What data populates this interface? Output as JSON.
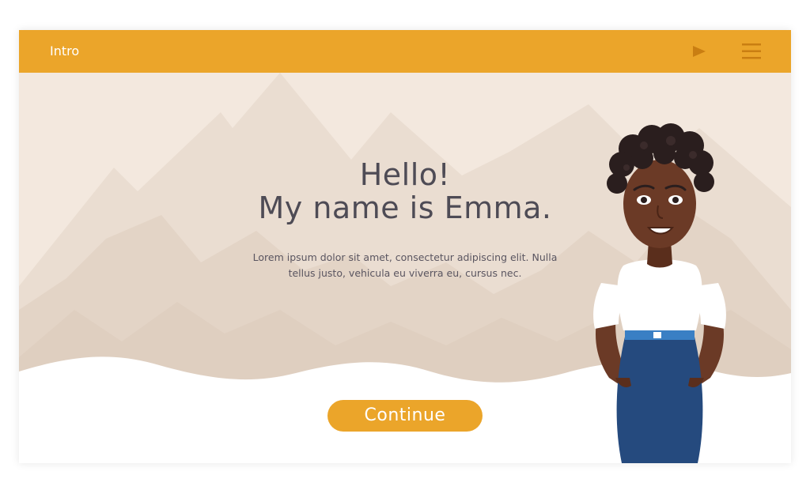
{
  "header": {
    "title": "Intro",
    "play_icon": "play-icon",
    "menu_icon": "hamburger-menu-icon"
  },
  "main": {
    "heading_line1": "Hello!",
    "heading_line2": "My name is Emma.",
    "body_line1": "Lorem ipsum dolor sit amet, consectetur adipiscing elit. Nulla",
    "body_line2": "tellus justo, vehicula eu viverra eu, cursus nec.",
    "continue_label": "Continue"
  },
  "colors": {
    "accent": "#EBA52A",
    "background": "#F3E8DE",
    "mountain_light": "#EADDD1",
    "mountain_mid": "#E2D3C6",
    "text_dark": "#4E4B55",
    "skirt": "#254A7E",
    "belt": "#3A7FC4",
    "skin": "#6B3A26",
    "hair": "#2A1E1E"
  }
}
